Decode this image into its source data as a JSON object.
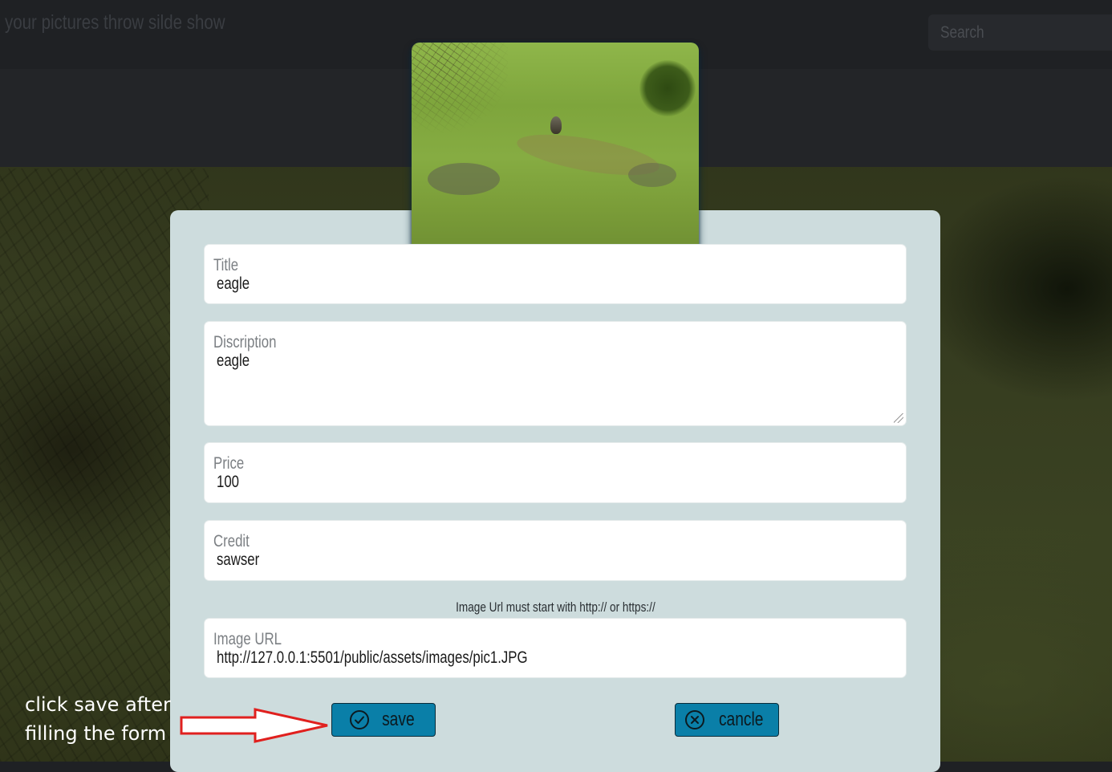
{
  "header": {
    "brand": "your pictures throw silde show",
    "search_placeholder": "Search"
  },
  "image_preview": {
    "subject": "eagle in grass field"
  },
  "form": {
    "title": {
      "label": "Title",
      "value": "eagle"
    },
    "description": {
      "label": "Discription",
      "value": "eagle"
    },
    "price": {
      "label": "Price",
      "value": "100"
    },
    "credit": {
      "label": "Credit",
      "value": "sawser"
    },
    "url_hint": "Image Url must start with http:// or https://",
    "image_url": {
      "label": "Image URL",
      "value": "http://127.0.0.1:5501/public/assets/images/pic1.JPG"
    },
    "save_label": "save",
    "cancel_label": "cancle"
  },
  "annotation": {
    "line1": "click save after",
    "line2": "filling the form"
  },
  "colors": {
    "button": "#0a7fa8",
    "card": "#cddcdd",
    "arrow": "#e0201e"
  },
  "icons": {
    "save": "check-circle-icon",
    "cancel": "x-circle-icon"
  }
}
